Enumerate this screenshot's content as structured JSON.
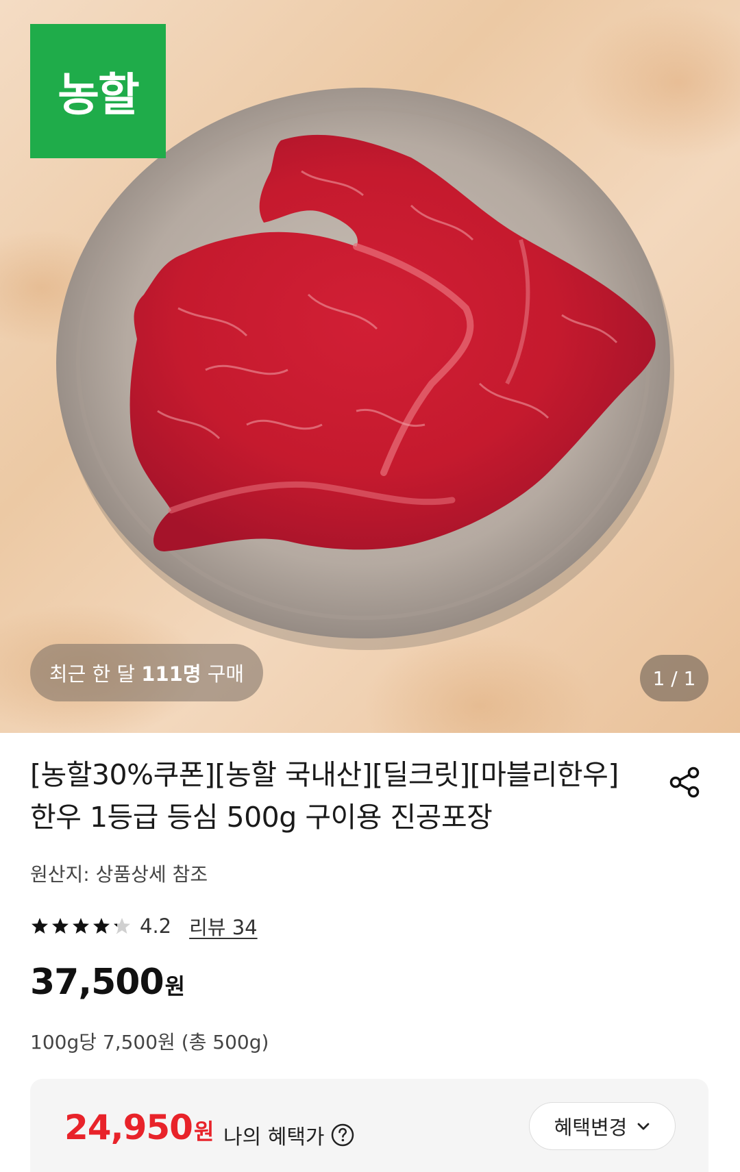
{
  "image": {
    "logo_text": "농할",
    "buyers_prefix": "최근 한 달 ",
    "buyers_count": "111명",
    "buyers_suffix": " 구매",
    "counter": "1 / 1"
  },
  "product": {
    "title": "[농할30%쿠폰][농할 국내산][딜크릿][마블리한우] 한우 1등급 등심 500g 구이용 진공포장",
    "origin": "원산지: 상품상세 참조",
    "rating": "4.2",
    "rating_stars": 4.2,
    "reviews": "리뷰 34",
    "price": "37,500",
    "price_unit": "원",
    "unit_price": "100g당 7,500원 (총 500g)"
  },
  "benefit": {
    "price": "24,950",
    "price_unit": "원",
    "label": "나의 혜택가",
    "change_button": "혜택변경",
    "accent_color": "#e8232a"
  },
  "icons": {
    "share": "share-icon",
    "help": "question-circle-icon",
    "chevron": "chevron-down-icon",
    "star": "star-icon"
  },
  "colors": {
    "logo_bg": "#1fac4a"
  }
}
